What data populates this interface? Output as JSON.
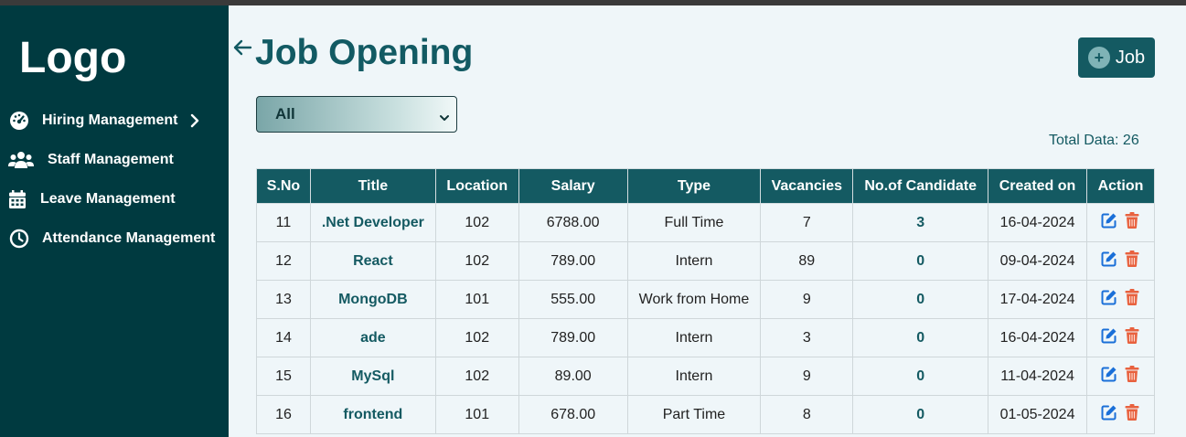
{
  "sidebar": {
    "logo": "Logo",
    "items": [
      {
        "label": "Hiring Management",
        "icon": "gauge-icon"
      },
      {
        "label": "Staff Management",
        "icon": "users-icon"
      },
      {
        "label": "Leave Management",
        "icon": "calendar-icon"
      },
      {
        "label": "Attendance Management",
        "icon": "clock-icon"
      }
    ]
  },
  "header": {
    "title": "Job Opening",
    "add_button_label": "Job"
  },
  "filter": {
    "selected": "All"
  },
  "summary": {
    "total": "Total Data: 26"
  },
  "table": {
    "columns": [
      "S.No",
      "Title",
      "Location",
      "Salary",
      "Type",
      "Vacancies",
      "No.of Candidate",
      "Created on",
      "Action"
    ],
    "rows": [
      {
        "sno": "11",
        "title": ".Net Developer",
        "location": "102",
        "salary": "6788.00",
        "type": "Full Time",
        "vacancies": "7",
        "candidates": "3",
        "created": "16-04-2024"
      },
      {
        "sno": "12",
        "title": "React",
        "location": "102",
        "salary": "789.00",
        "type": "Intern",
        "vacancies": "89",
        "candidates": "0",
        "created": "09-04-2024"
      },
      {
        "sno": "13",
        "title": "MongoDB",
        "location": "101",
        "salary": "555.00",
        "type": "Work from Home",
        "vacancies": "9",
        "candidates": "0",
        "created": "17-04-2024"
      },
      {
        "sno": "14",
        "title": "ade",
        "location": "102",
        "salary": "789.00",
        "type": "Intern",
        "vacancies": "3",
        "candidates": "0",
        "created": "16-04-2024"
      },
      {
        "sno": "15",
        "title": "MySql",
        "location": "102",
        "salary": "89.00",
        "type": "Intern",
        "vacancies": "9",
        "candidates": "0",
        "created": "11-04-2024"
      },
      {
        "sno": "16",
        "title": "frontend",
        "location": "101",
        "salary": "678.00",
        "type": "Part Time",
        "vacancies": "8",
        "candidates": "0",
        "created": "01-05-2024"
      }
    ]
  },
  "colors": {
    "sidebar_bg": "#003a40",
    "accent": "#145a62",
    "page_bg": "#eff6f9",
    "edit_icon": "#1a6fd8",
    "delete_icon": "#e8613e"
  }
}
